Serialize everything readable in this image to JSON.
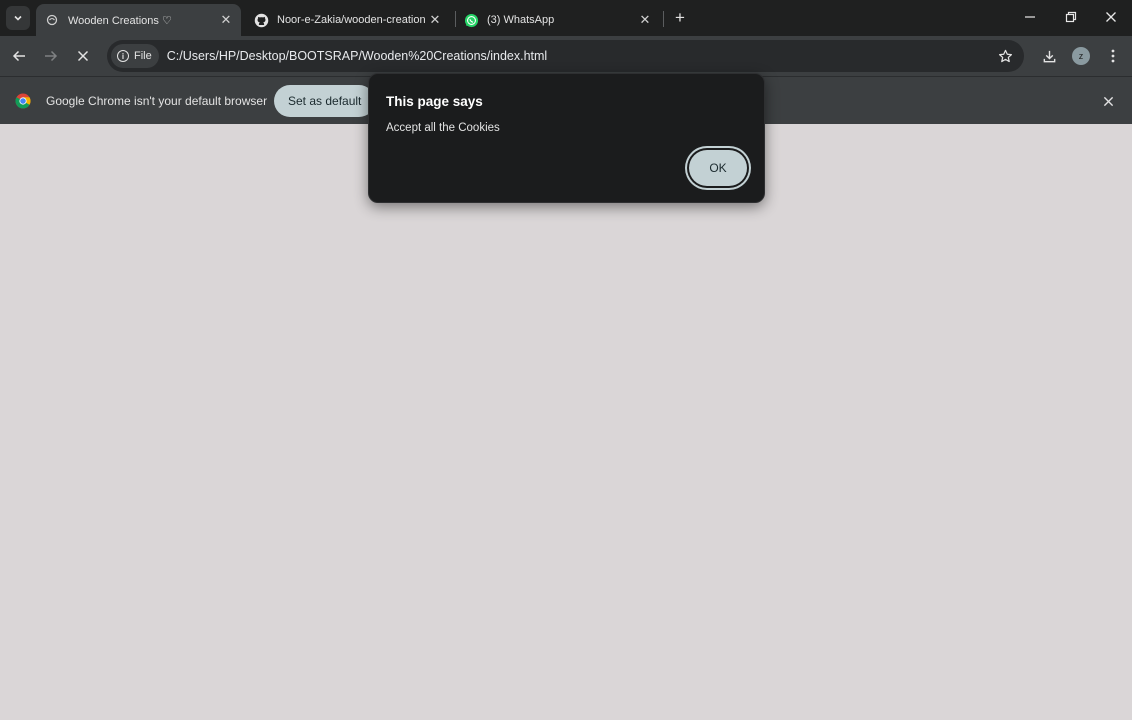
{
  "tabs": [
    {
      "title": "Wooden Creations ♡",
      "favicon": "page-icon",
      "active": true
    },
    {
      "title": "Noor-e-Zakia/wooden-creation",
      "favicon": "github-icon",
      "active": false
    },
    {
      "title": "(3) WhatsApp",
      "favicon": "whatsapp-icon",
      "active": false
    }
  ],
  "toolbar": {
    "chip_label": "File",
    "url": "C:/Users/HP/Desktop/BOOTSRAP/Wooden%20Creations/index.html",
    "profile_initial": "z"
  },
  "infobar": {
    "message": "Google Chrome isn't your default browser",
    "button_label": "Set as default"
  },
  "dialog": {
    "title": "This page says",
    "message": "Accept all the Cookies",
    "ok_label": "OK"
  },
  "colors": {
    "page_background": "#dad6d7",
    "accent_button": "#c3d1d4",
    "dialog_background": "#1b1c1d"
  }
}
